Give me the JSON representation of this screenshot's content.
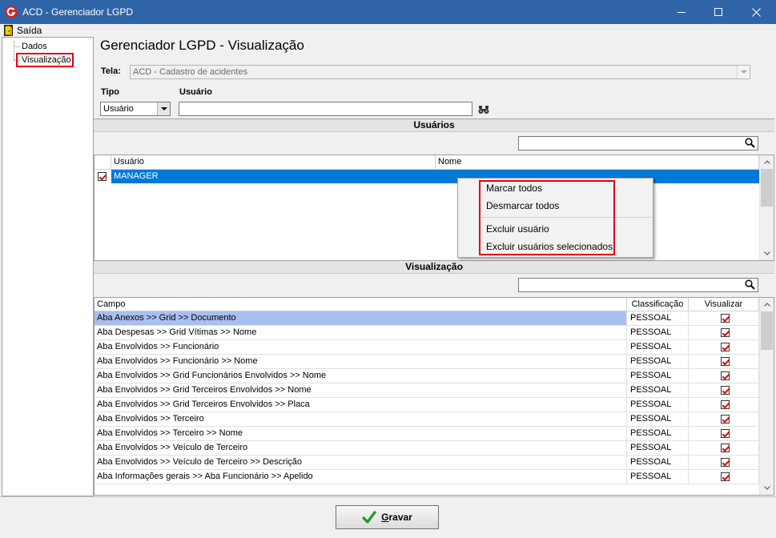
{
  "window": {
    "title": "ACD - Gerenciador LGPD"
  },
  "menu": {
    "exit_label": "Saída"
  },
  "tree": {
    "items": [
      {
        "label": "Dados"
      },
      {
        "label": "Visualização"
      }
    ]
  },
  "page_title": "Gerenciador LGPD - Visualização",
  "form": {
    "tela_label": "Tela:",
    "tela_value": "ACD - Cadastro de acidentes",
    "tipo_label": "Tipo",
    "tipo_value": "Usuário",
    "usuario_label": "Usuário",
    "usuario_value": ""
  },
  "users_section": {
    "title": "Usuários",
    "search_value": "",
    "columns": {
      "usuario": "Usuário",
      "nome": "Nome"
    },
    "rows": [
      {
        "usuario": "MANAGER",
        "nome": "",
        "checked": true,
        "selected": true
      }
    ]
  },
  "context_menu": {
    "items": [
      {
        "label": "Marcar todos"
      },
      {
        "label": "Desmarcar todos"
      },
      {
        "label": "Excluir usuário"
      },
      {
        "label": "Excluir usuários selecionados"
      }
    ]
  },
  "view_section": {
    "title": "Visualização",
    "search_value": "",
    "columns": {
      "campo": "Campo",
      "classificacao": "Classificação",
      "visualizar": "Visualizar"
    },
    "rows": [
      {
        "campo": "Aba Anexos >> Grid >> Documento",
        "classificacao": "PESSOAL",
        "visualizar": true,
        "selected": true
      },
      {
        "campo": "Aba Despesas >> Grid Vítimas >> Nome",
        "classificacao": "PESSOAL",
        "visualizar": true
      },
      {
        "campo": "Aba Envolvidos >> Funcionário",
        "classificacao": "PESSOAL",
        "visualizar": true
      },
      {
        "campo": "Aba Envolvidos >> Funcionário >> Nome",
        "classificacao": "PESSOAL",
        "visualizar": true
      },
      {
        "campo": "Aba Envolvidos >> Grid Funcionários Envolvidos >> Nome",
        "classificacao": "PESSOAL",
        "visualizar": true
      },
      {
        "campo": "Aba Envolvidos >> Grid Terceiros Envolvidos >> Nome",
        "classificacao": "PESSOAL",
        "visualizar": true
      },
      {
        "campo": "Aba Envolvidos >> Grid Terceiros Envolvidos >> Placa",
        "classificacao": "PESSOAL",
        "visualizar": true
      },
      {
        "campo": "Aba Envolvidos >> Terceiro",
        "classificacao": "PESSOAL",
        "visualizar": true
      },
      {
        "campo": "Aba Envolvidos >> Terceiro >> Nome",
        "classificacao": "PESSOAL",
        "visualizar": true
      },
      {
        "campo": "Aba Envolvidos >> Veículo de Terceiro",
        "classificacao": "PESSOAL",
        "visualizar": true
      },
      {
        "campo": "Aba Envolvidos >> Veículo de Terceiro >> Descrição",
        "classificacao": "PESSOAL",
        "visualizar": true
      },
      {
        "campo": "Aba Informações gerais >> Aba Funcionário >> Apelido",
        "classificacao": "PESSOAL",
        "visualizar": true
      }
    ]
  },
  "footer": {
    "save_label": "Gravar"
  },
  "icons": {
    "app": "app-logo-icon",
    "exit": "exit-door-icon",
    "search": "search-icon",
    "binoculars": "binoculars-icon",
    "save": "check-icon"
  },
  "colors": {
    "titlebar": "#2f65a7",
    "title_text": "#ffffff",
    "selection": "#0078d7",
    "row_highlight": "#a8bff0",
    "checkmark": "#cc1010",
    "annotation": "#e60012",
    "save_check": "#1e9a28"
  }
}
